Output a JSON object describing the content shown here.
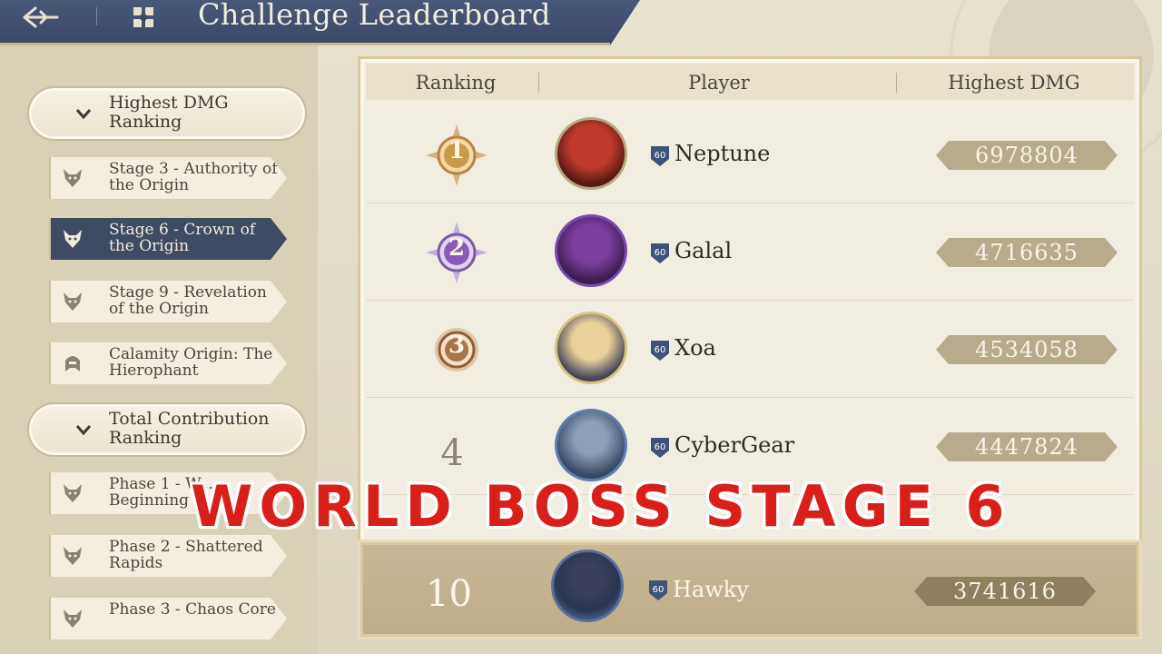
{
  "header": {
    "title": "Challenge Leaderboard",
    "back_icon": "back-arrow-icon",
    "home_icon": "home-icon"
  },
  "sidebar": {
    "categories": [
      {
        "label": "Highest DMG Ranking",
        "expanded": true,
        "items": [
          {
            "label": "Stage 3 - Authority of the Origin",
            "icon": "wolf-icon",
            "active": false
          },
          {
            "label": "Stage 6 - Crown of the Origin",
            "icon": "wolf-icon",
            "active": true
          },
          {
            "label": "Stage 9 - Revelation of the Origin",
            "icon": "wolf-icon",
            "active": false
          },
          {
            "label": "Calamity Origin: The Hierophant",
            "icon": "helmet-icon",
            "active": false
          }
        ]
      },
      {
        "label": "Total Contribution Ranking",
        "expanded": true,
        "items": [
          {
            "label": "Phase 1 - W... Beginning",
            "icon": "wolf-icon",
            "active": false
          },
          {
            "label": "Phase 2 - Shattered Rapids",
            "icon": "wolf-icon",
            "active": false
          },
          {
            "label": "Phase 3 - Chaos Core",
            "icon": "wolf-icon",
            "active": false
          }
        ]
      }
    ]
  },
  "leaderboard": {
    "columns": [
      "Ranking",
      "Player",
      "Highest DMG"
    ],
    "rows": [
      {
        "rank": "1",
        "player": "Neptune",
        "level": "60",
        "dmg": "6978804",
        "medal_color": "#c89a4a"
      },
      {
        "rank": "2",
        "player": "Galal",
        "level": "60",
        "dmg": "4716635",
        "medal_color": "#8a5ab8"
      },
      {
        "rank": "3",
        "player": "Xoa",
        "level": "60",
        "dmg": "4534058",
        "medal_color": "#a8744a"
      },
      {
        "rank": "4",
        "player": "CyberGear",
        "level": "60",
        "dmg": "4447824",
        "medal_color": ""
      }
    ],
    "my_row": {
      "rank": "10",
      "player": "Hawky",
      "level": "60",
      "dmg": "3741616"
    }
  },
  "overlay": {
    "caption": "WORLD BOSS STAGE 6",
    "color": "#d91f1a"
  }
}
